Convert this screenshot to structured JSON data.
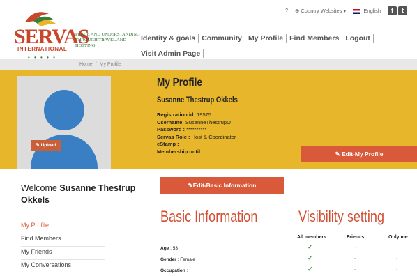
{
  "header": {
    "logo_word": "SERVAS",
    "logo_sub": "INTERNATIONAL",
    "logo_dots": "• • • • •",
    "tagline": "PEACE AND UNDERSTANDING THROUGH TRAVEL AND HOSTING",
    "topbar": {
      "help": "?",
      "country_websites": "Country Websites",
      "language": "English"
    },
    "nav": [
      "Identity & goals",
      "Community",
      "My Profile",
      "Find Members",
      "Logout"
    ],
    "nav2": "Visit Admin Page"
  },
  "breadcrumb": [
    "Home",
    "My Profile"
  ],
  "profile": {
    "title": "My Profile",
    "name": "Susanne Thestrup Okkels",
    "upload_label": "Upload",
    "fields": [
      {
        "label": "Registration id:",
        "value": " 19575"
      },
      {
        "label": "Username:",
        "value": " SusanneThestrupO"
      },
      {
        "label": "Password :",
        "value": " **********"
      },
      {
        "label": "Servas Role :",
        "value": " Host & Coordinator"
      },
      {
        "label": "eStamp :",
        "value": ""
      },
      {
        "label": "Membership until :",
        "value": ""
      }
    ],
    "edit_profile_label": "Edit-My Profile"
  },
  "sidebar": {
    "welcome_prefix": "Welcome ",
    "welcome_name": "Susanne Thestrup Okkels",
    "items": [
      "My Profile",
      "Find Members",
      "My Friends",
      "My Conversations"
    ]
  },
  "main": {
    "edit_basic_label": "Edit-Basic Information",
    "basic_heading": "Basic Information",
    "visibility_heading": "Visibility setting",
    "vis_columns": [
      "All members",
      "Friends",
      "Only me"
    ],
    "rows": [
      {
        "label": "Age",
        "value": " 53"
      },
      {
        "label": "Gender",
        "value": " Female"
      },
      {
        "label": "Occupation",
        "value": ""
      }
    ]
  }
}
